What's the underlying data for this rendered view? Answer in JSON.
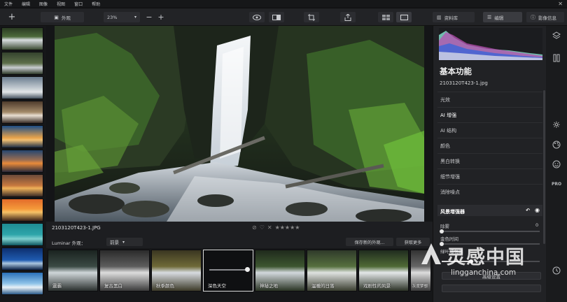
{
  "menu": [
    "文件",
    "编辑",
    "图像",
    "视图",
    "窗口",
    "帮助"
  ],
  "toolbar": {
    "album_label": "外观",
    "zoom_value": "23%",
    "library_label": "资料库",
    "edit_label": "编辑",
    "info_label": "影像信息"
  },
  "image": {
    "filename": "2103120T423-1.JPG",
    "stars": "★★★★★"
  },
  "looks": {
    "title": "Luminar 外观：",
    "category": "前景",
    "save_label": "保存新的外观...",
    "more_label": "获取更多",
    "items": [
      {
        "label": "震霸"
      },
      {
        "label": "复古黑白"
      },
      {
        "label": "秋季颜色"
      },
      {
        "label": "深色天空"
      },
      {
        "label": "神秘之地"
      },
      {
        "label": "温暖的日落"
      },
      {
        "label": "戏剧性的风景"
      },
      {
        "label": "灰度梦想"
      }
    ]
  },
  "panel": {
    "title": "基本功能",
    "file": "2103120T423-1.jpg",
    "tools": [
      "光效",
      "AI 增强",
      "AI 结构",
      "颜色",
      "黑白转换",
      "细节增强",
      "消除噪点"
    ],
    "active_tool": "风景增强器",
    "slider1_label": "除雾",
    "slider1_value": "0",
    "slider2_label": "金色时间",
    "slider3_label": "绿叶增强器",
    "advanced_label": "高级设置"
  },
  "watermark": {
    "text": "灵感中国",
    "url": "lingganchina.com"
  }
}
